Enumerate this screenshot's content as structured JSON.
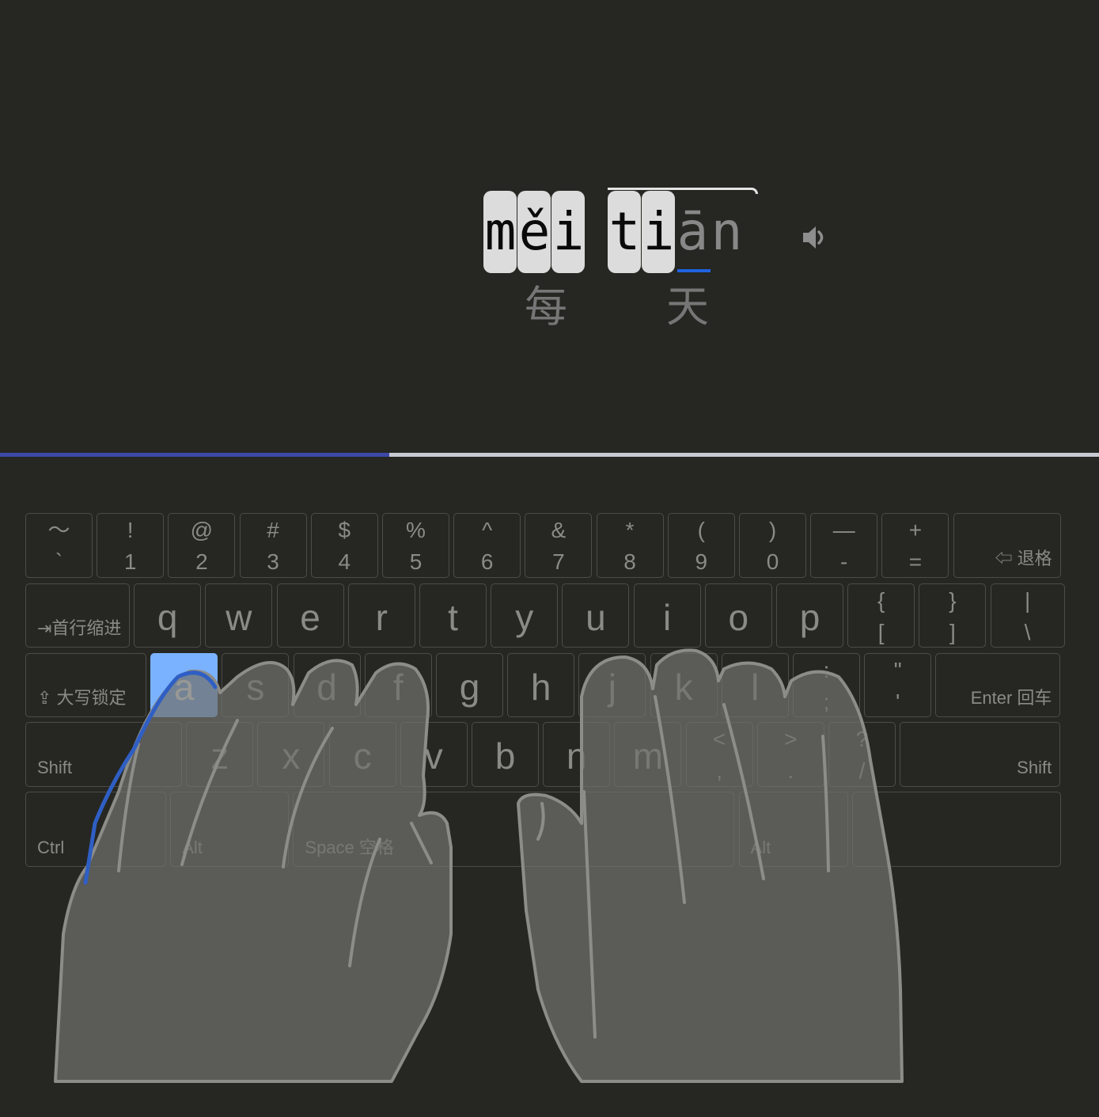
{
  "lesson": {
    "syllables": [
      {
        "letters": [
          {
            "ch": "m",
            "state": "typed"
          },
          {
            "ch": "ě",
            "state": "typed"
          },
          {
            "ch": "i",
            "state": "typed"
          }
        ]
      },
      {
        "letters": [
          {
            "ch": "t",
            "state": "typed"
          },
          {
            "ch": "i",
            "state": "typed"
          },
          {
            "ch": "ā",
            "state": "pending"
          },
          {
            "ch": "n",
            "state": "pending"
          }
        ]
      }
    ],
    "hanzi": [
      "每",
      "天"
    ]
  },
  "speaker_icon": "speaker-icon",
  "progress": {
    "fraction": 0.354
  },
  "keyboard": {
    "rows": [
      [
        {
          "id": "backtick",
          "top": "～",
          "bottom": "`"
        },
        {
          "id": "1",
          "top": "!",
          "bottom": "1"
        },
        {
          "id": "2",
          "top": "@",
          "bottom": "2"
        },
        {
          "id": "3",
          "top": "#",
          "bottom": "3"
        },
        {
          "id": "4",
          "top": "$",
          "bottom": "4"
        },
        {
          "id": "5",
          "top": "%",
          "bottom": "5"
        },
        {
          "id": "6",
          "top": "^",
          "bottom": "6"
        },
        {
          "id": "7",
          "top": "&",
          "bottom": "7"
        },
        {
          "id": "8",
          "top": "*",
          "bottom": "8"
        },
        {
          "id": "9",
          "top": "(",
          "bottom": "9"
        },
        {
          "id": "0",
          "top": ")",
          "bottom": "0"
        },
        {
          "id": "minus",
          "top": "—",
          "bottom": "-"
        },
        {
          "id": "equals",
          "top": "+",
          "bottom": "="
        },
        {
          "id": "backspace",
          "label": "⇦ 退格",
          "align": "right"
        }
      ],
      [
        {
          "id": "tab",
          "label": "⇥首行缩进",
          "align": "left"
        },
        {
          "id": "q",
          "main": "q"
        },
        {
          "id": "w",
          "main": "w"
        },
        {
          "id": "e",
          "main": "e"
        },
        {
          "id": "r",
          "main": "r"
        },
        {
          "id": "t",
          "main": "t"
        },
        {
          "id": "y",
          "main": "y"
        },
        {
          "id": "u",
          "main": "u"
        },
        {
          "id": "i",
          "main": "i"
        },
        {
          "id": "o",
          "main": "o"
        },
        {
          "id": "p",
          "main": "p"
        },
        {
          "id": "lbracket",
          "top": "{",
          "bottom": "["
        },
        {
          "id": "rbracket",
          "top": "}",
          "bottom": "]"
        },
        {
          "id": "backslash",
          "top": "|",
          "bottom": "\\"
        }
      ],
      [
        {
          "id": "capslock",
          "label": "⇪ 大写锁定",
          "align": "left"
        },
        {
          "id": "a",
          "main": "a",
          "active": true
        },
        {
          "id": "s",
          "main": "s"
        },
        {
          "id": "d",
          "main": "d"
        },
        {
          "id": "f",
          "main": "f"
        },
        {
          "id": "g",
          "main": "g"
        },
        {
          "id": "h",
          "main": "h"
        },
        {
          "id": "j",
          "main": "j"
        },
        {
          "id": "k",
          "main": "k"
        },
        {
          "id": "l",
          "main": "l"
        },
        {
          "id": "semicolon",
          "top": ":",
          "bottom": ";"
        },
        {
          "id": "quote",
          "top": "\"",
          "bottom": "'"
        },
        {
          "id": "enter",
          "label": "Enter 回车",
          "align": "right"
        }
      ],
      [
        {
          "id": "lshift",
          "label": "Shift",
          "align": "left"
        },
        {
          "id": "z",
          "main": "z"
        },
        {
          "id": "x",
          "main": "x"
        },
        {
          "id": "c",
          "main": "c"
        },
        {
          "id": "v",
          "main": "v"
        },
        {
          "id": "b",
          "main": "b"
        },
        {
          "id": "n",
          "main": "n"
        },
        {
          "id": "m",
          "main": "m"
        },
        {
          "id": "comma",
          "top": "<",
          "bottom": ","
        },
        {
          "id": "period",
          "top": ">",
          "bottom": "."
        },
        {
          "id": "slash",
          "top": "?",
          "bottom": "/"
        },
        {
          "id": "rshift",
          "label": "Shift",
          "align": "right"
        }
      ],
      [
        {
          "id": "ctrl",
          "label": "Ctrl",
          "align": "left"
        },
        {
          "id": "lalt",
          "label": "Alt",
          "align": "left"
        },
        {
          "id": "space",
          "label": "Space 空格",
          "align": "left"
        },
        {
          "id": "ralt",
          "label": "Alt",
          "align": "left"
        },
        {
          "id": "rctrl",
          "label": "",
          "align": "left"
        }
      ]
    ]
  },
  "colors": {
    "background": "#262622",
    "active_key": "#7ab2ff",
    "progress_fill": "#3d48a8",
    "progress_track": "#c9c9d4",
    "cursor": "#1e63e0",
    "finger_guide": "#2f5fc4"
  }
}
